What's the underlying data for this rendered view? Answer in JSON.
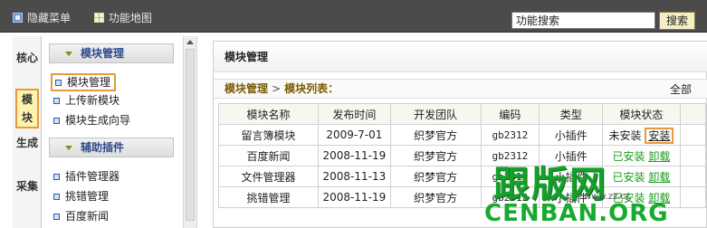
{
  "topbar": {
    "hide_menu_label": "隐藏菜单",
    "function_map_label": "功能地图",
    "search_value": "功能搜索",
    "search_button": "搜索"
  },
  "left_tabs": [
    "核心",
    "模块",
    "生成",
    "采集"
  ],
  "active_left_tab": "模块",
  "sidebar": {
    "sections": [
      {
        "title": "模块管理",
        "items": [
          "模块管理",
          "上传新模块",
          "模块生成向导"
        ]
      },
      {
        "title": "辅助插件",
        "items": [
          "插件管理器",
          "挑错管理",
          "百度新闻"
        ]
      }
    ],
    "active_item": "模块管理"
  },
  "main": {
    "title": "模块管理",
    "breadcrumb": {
      "root": "模块管理",
      "separator": ">",
      "current": "模块列表："
    },
    "filter_label": "全部",
    "table": {
      "headers": [
        "模块名称",
        "发布时间",
        "开发团队",
        "编码",
        "类型",
        "模块状态"
      ],
      "rows": [
        {
          "name": "留言簿模块",
          "date": "2009-7-01",
          "team": "织梦官方",
          "code": "gb2312",
          "type": "小插件",
          "status": "未安装",
          "action": "安装"
        },
        {
          "name": "百度新闻",
          "date": "2008-11-19",
          "team": "织梦官方",
          "code": "gb2312",
          "type": "小插件",
          "status": "已安装",
          "action": "卸载"
        },
        {
          "name": "文件管理器",
          "date": "2008-11-13",
          "team": "织梦官方",
          "code": "gb2312",
          "type": "小插件",
          "status": "已安装",
          "action": "卸载"
        },
        {
          "name": "挑错管理",
          "date": "2008-11-19",
          "team": "织梦官方",
          "code": "gb2312",
          "type": "小插件",
          "status": "已安装",
          "action": "卸载"
        }
      ]
    }
  },
  "watermark": {
    "line1": "跟版网",
    "line2": "CENBAN.ORG",
    "site": "www.zz.cc"
  },
  "colors": {
    "accent_orange": "#e69a3d",
    "installed_green": "#1a9c1a",
    "topbar_bg": "#4b4b4b"
  }
}
